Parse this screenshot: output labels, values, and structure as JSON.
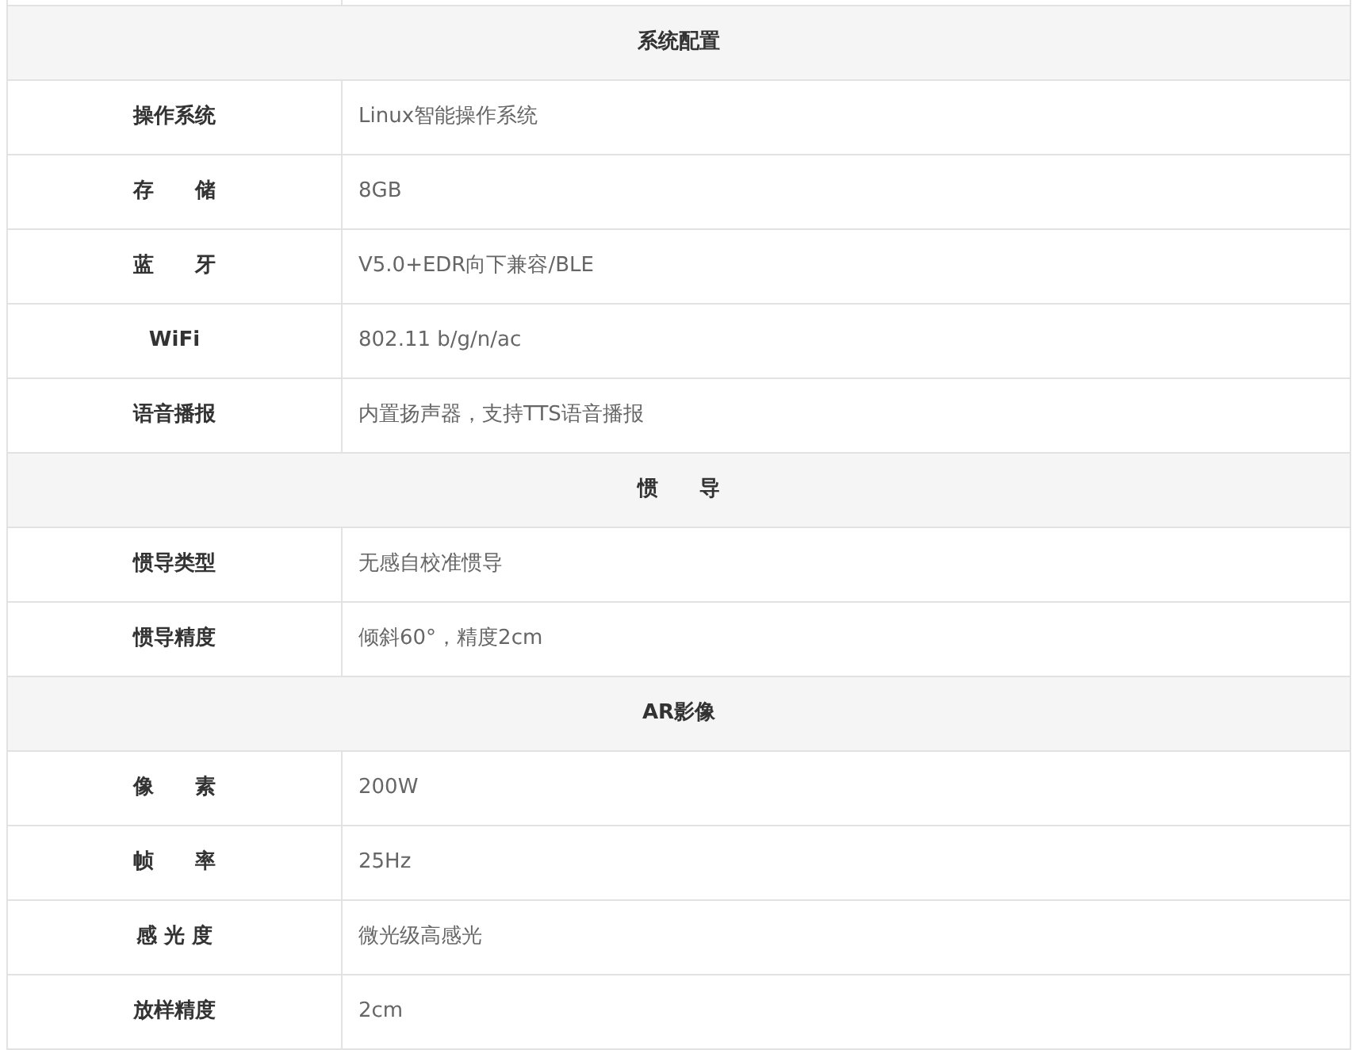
{
  "sections": [
    {
      "title": "系统配置",
      "rows": [
        {
          "label": "操作系统",
          "value": "Linux智能操作系统"
        },
        {
          "label": "存　　储",
          "value": "8GB"
        },
        {
          "label": "蓝　　牙",
          "value": "V5.0+EDR向下兼容/BLE"
        },
        {
          "label": "WiFi",
          "value": "802.11 b/g/n/ac"
        },
        {
          "label": "语音播报",
          "value": "内置扬声器，支持TTS语音播报"
        }
      ]
    },
    {
      "title": "惯　　导",
      "rows": [
        {
          "label": "惯导类型",
          "value": "无感自校准惯导"
        },
        {
          "label": "惯导精度",
          "value": "倾斜60°，精度2cm"
        }
      ]
    },
    {
      "title": "AR影像",
      "rows": [
        {
          "label": "像　　素",
          "value": "200W"
        },
        {
          "label": "帧　　率",
          "value": "25Hz"
        },
        {
          "label": "感 光 度",
          "value": "微光级高感光"
        },
        {
          "label": "放样精度",
          "value": "2cm"
        }
      ]
    }
  ]
}
